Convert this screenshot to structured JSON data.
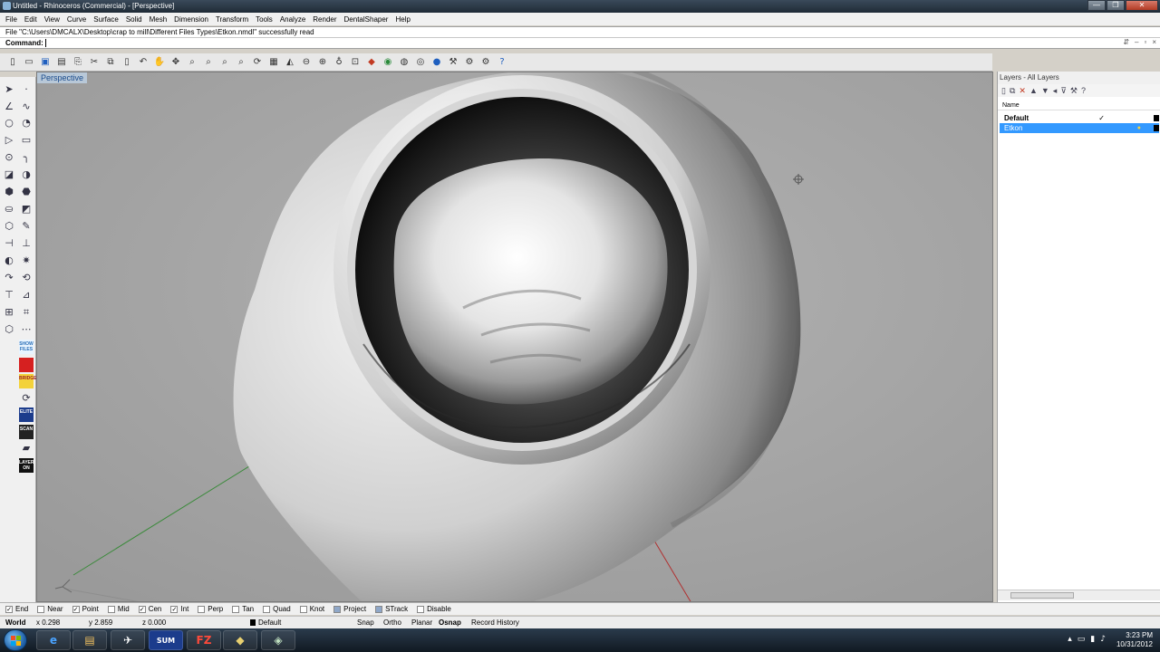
{
  "window": {
    "title": "Untitled - Rhinoceros (Commercial) - [Perspective]",
    "controls": [
      "—",
      "❐",
      "✕"
    ]
  },
  "menu": [
    "File",
    "Edit",
    "View",
    "Curve",
    "Surface",
    "Solid",
    "Mesh",
    "Dimension",
    "Transform",
    "Tools",
    "Analyze",
    "Render",
    "DentalShaper",
    "Help"
  ],
  "command": {
    "history": "File \"C:\\Users\\DMCALX\\Desktop\\crap to mill\\Different Files Types\\Etkon.nmdl\" successfully read",
    "prompt": "Command:"
  },
  "toolbar_icons": [
    "new-icon",
    "open-icon",
    "save-icon",
    "print-icon",
    "import-icon",
    "cut-icon",
    "copy-icon",
    "paste-icon",
    "pan-icon",
    "move-icon",
    "zoom-icon",
    "zoom-window-icon",
    "zoom-extents-icon",
    "rotate-icon",
    "grid-icon",
    "car-icon",
    "layer-icon",
    "properties-icon",
    "bulb-icon",
    "lock-icon",
    "material-icon",
    "color-wheel-icon",
    "render-sphere-icon",
    "globe-icon",
    "help-icon"
  ],
  "viewport": {
    "name": "Perspective"
  },
  "layers": {
    "title": "Layers - All Layers",
    "column_name": "Name",
    "rows": [
      {
        "name": "Default",
        "check": "✓",
        "selected": false
      },
      {
        "name": "Etkon",
        "check": "",
        "selected": true
      }
    ]
  },
  "osnaps": [
    {
      "label": "End",
      "checked": true
    },
    {
      "label": "Near",
      "checked": false
    },
    {
      "label": "Point",
      "checked": true
    },
    {
      "label": "Mid",
      "checked": false
    },
    {
      "label": "Cen",
      "checked": true
    },
    {
      "label": "Int",
      "checked": true
    },
    {
      "label": "Perp",
      "checked": false
    },
    {
      "label": "Tan",
      "checked": false
    },
    {
      "label": "Quad",
      "checked": false
    },
    {
      "label": "Knot",
      "checked": false
    },
    {
      "label": "Project",
      "checked": false
    },
    {
      "label": "STrack",
      "checked": false
    },
    {
      "label": "Disable",
      "checked": false
    }
  ],
  "status": {
    "cplane": "World",
    "x": "x 0.298",
    "y": "y 2.859",
    "z": "z 0.000",
    "layer": "Default",
    "snap": "Snap",
    "ortho": "Ortho",
    "planar": "Planar",
    "osnap": "Osnap",
    "history": "Record History"
  },
  "plugins": [
    {
      "label": "SHOW FILES",
      "bg": "#e8f4ff",
      "fg": "#2a6fb8"
    },
    {
      "label": "",
      "bg": "#d62020",
      "fg": "#fff"
    },
    {
      "label": "BRIDGE",
      "bg": "#f3d23a",
      "fg": "#a02020"
    },
    {
      "label": "ELITE",
      "bg": "#1c3c8c",
      "fg": "#fff"
    },
    {
      "label": "SCAN",
      "bg": "#222",
      "fg": "#fff"
    },
    {
      "label": "LAYER ON",
      "bg": "#111",
      "fg": "#fff"
    }
  ],
  "taskbar": {
    "apps": [
      "e",
      "▤",
      "✈",
      "SUM",
      "FZ",
      "◆",
      "◈"
    ],
    "time": "3:23 PM",
    "date": "10/31/2012"
  },
  "colors": {
    "selection": "#3399ff",
    "viewport_bg": "#a8a8a8",
    "x_axis": "#b03030",
    "y_axis": "#3a8a3a"
  }
}
